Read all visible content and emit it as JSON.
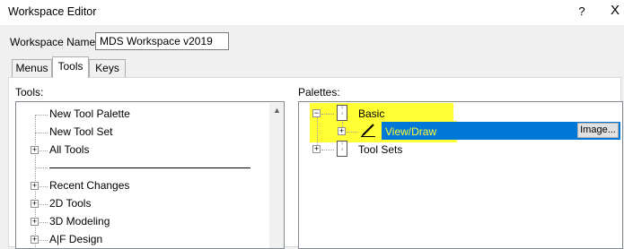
{
  "window": {
    "title": "Workspace Editor",
    "help_label": "?",
    "close_label": "X"
  },
  "workspace": {
    "label": "Workspace Name:",
    "value": "MDS Workspace v2019"
  },
  "tabs": [
    {
      "label": "Menus"
    },
    {
      "label": "Tools"
    },
    {
      "label": "Keys"
    }
  ],
  "tools": {
    "label": "Tools:",
    "items": [
      {
        "label": "New Tool Palette"
      },
      {
        "label": "New Tool Set"
      },
      {
        "label": "All Tools"
      },
      {
        "label": "Recent Changes"
      },
      {
        "label": "2D Tools"
      },
      {
        "label": "3D Modeling"
      },
      {
        "label": "A|F Design"
      }
    ]
  },
  "palettes": {
    "label": "Palettes:",
    "items": [
      {
        "label": "Basic"
      },
      {
        "label": "View/Draw"
      },
      {
        "label": "Tool Sets"
      }
    ],
    "image_button": "Image...",
    "highlight_color": "#ffff33",
    "selection_color": "#0078d7"
  }
}
